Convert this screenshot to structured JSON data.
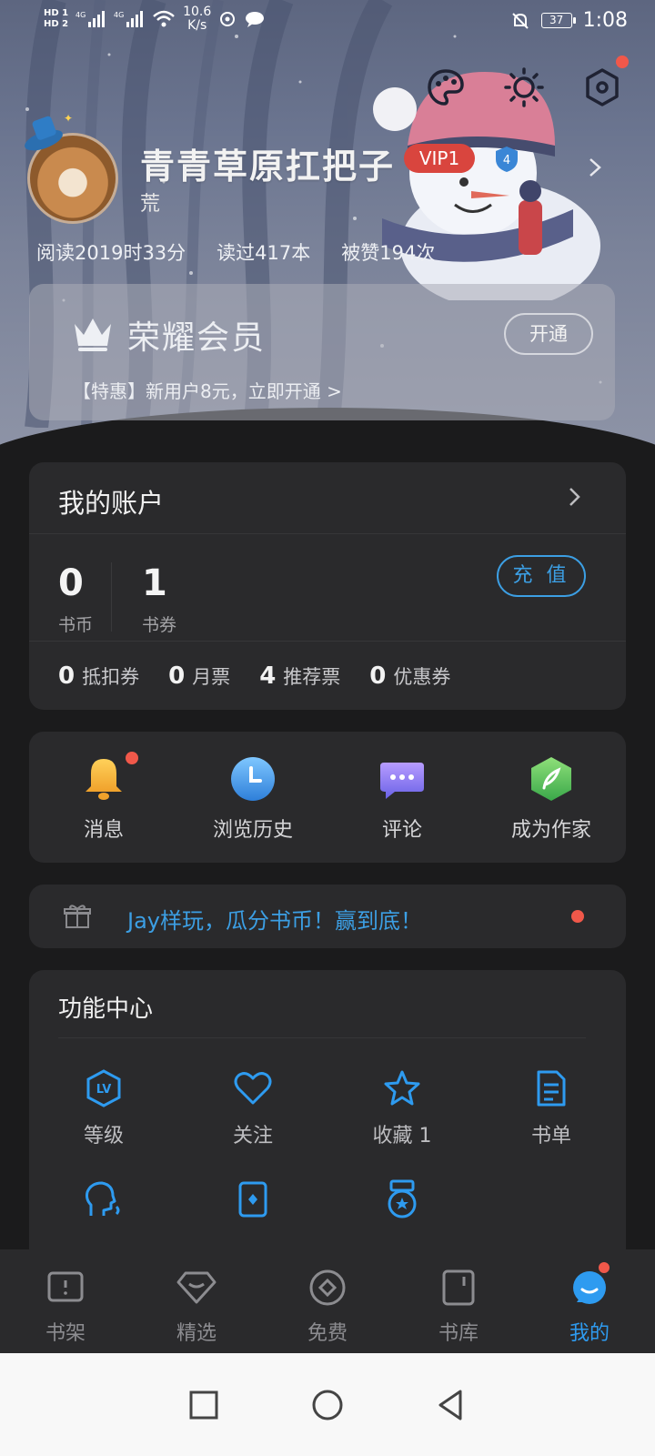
{
  "status_bar": {
    "hd1": "HD 1",
    "hd2": "HD 2",
    "sig1": "4G",
    "sig2": "4G",
    "net_speed": "10.6",
    "net_unit": "K/s",
    "battery": "37",
    "time": "1:08"
  },
  "profile": {
    "username": "青青草原扛把子",
    "vip": "VIP1",
    "level_shield": "4",
    "subtitle": "荒",
    "stats": [
      "阅读2019时33分",
      "读过417本",
      "被赞194次"
    ]
  },
  "honor": {
    "title": "荣耀会员",
    "button": "开通",
    "promo": "【特惠】新用户8元，立即开通 >"
  },
  "account": {
    "title": "我的账户",
    "balances": [
      {
        "value": "0",
        "label": "书币"
      },
      {
        "value": "1",
        "label": "书券"
      }
    ],
    "recharge": "充 值",
    "tickets": [
      {
        "value": "0",
        "label": "抵扣券"
      },
      {
        "value": "0",
        "label": "月票"
      },
      {
        "value": "4",
        "label": "推荐票"
      },
      {
        "value": "0",
        "label": "优惠券"
      }
    ]
  },
  "quick": [
    {
      "label": "消息",
      "icon": "bell-icon"
    },
    {
      "label": "浏览历史",
      "icon": "clock-icon"
    },
    {
      "label": "评论",
      "icon": "comment-icon"
    },
    {
      "label": "成为作家",
      "icon": "quill-icon"
    }
  ],
  "promo": {
    "text": "Jay样玩，瓜分书币！赢到底！"
  },
  "func": {
    "title": "功能中心",
    "items": [
      {
        "label": "等级",
        "icon": "level-icon"
      },
      {
        "label": "关注",
        "icon": "heart-icon"
      },
      {
        "label": "收藏 1",
        "icon": "star-icon"
      },
      {
        "label": "书单",
        "icon": "booklist-icon"
      },
      {
        "label": "",
        "icon": "voice-icon"
      },
      {
        "label": "",
        "icon": "card-icon"
      },
      {
        "label": "",
        "icon": "medal-icon"
      }
    ]
  },
  "nav": [
    {
      "label": "书架"
    },
    {
      "label": "精选"
    },
    {
      "label": "免费"
    },
    {
      "label": "书库"
    },
    {
      "label": "我的"
    }
  ],
  "colors": {
    "accent": "#3c9fe4",
    "badge": "#f0584a",
    "vip": "#d9453e",
    "card": "#2a2a2c",
    "bg": "#1b1b1c"
  }
}
